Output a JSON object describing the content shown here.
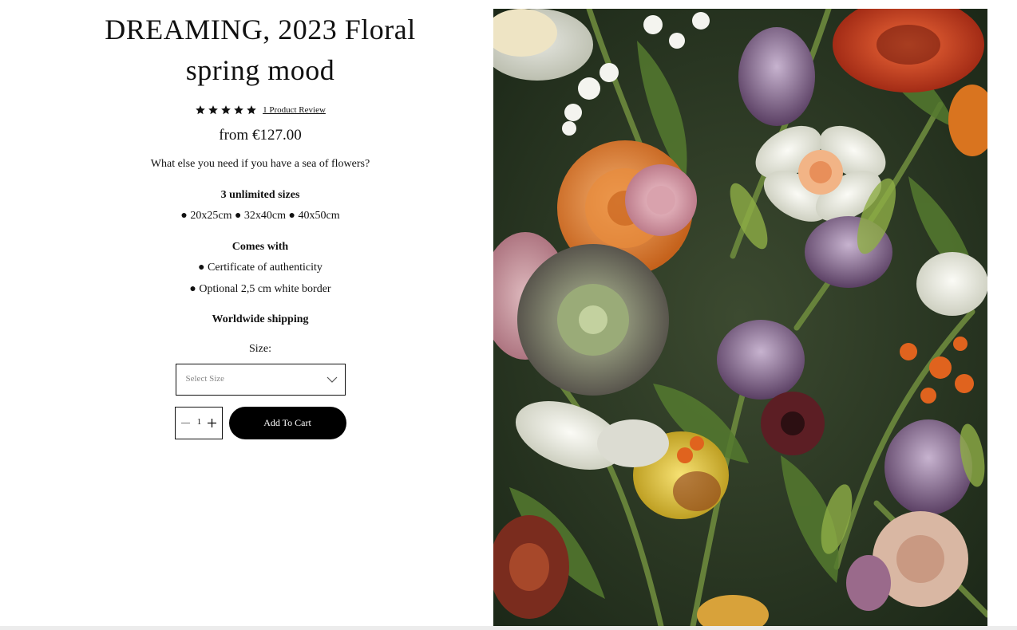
{
  "product": {
    "title": "DREAMING, 2023 Floral spring mood",
    "rating_stars": 5,
    "review_link": "1 Product Review",
    "price": "from €127.00",
    "description": "What else you need if you have a sea of flowers?",
    "sizes_heading": "3 unlimited sizes",
    "sizes_line": "● 20x25cm ● 32x40cm ● 40x50cm",
    "comes_with_heading": "Comes with",
    "comes_with_items": [
      "● Certificate of authenticity",
      "● Optional 2,5 cm white border"
    ],
    "shipping_heading": "Worldwide shipping",
    "size_label": "Size:",
    "size_select_placeholder": "Select Size",
    "quantity": "1",
    "add_to_cart_label": "Add To Cart"
  },
  "icons": {
    "star": "star-icon",
    "chevron": "chevron-down-icon",
    "minus": "minus-icon",
    "plus": "plus-icon"
  },
  "image": {
    "subject": "floral artwork"
  },
  "colors": {
    "button_bg": "#000000",
    "button_text": "#ffffff",
    "text": "#111111",
    "placeholder": "#888888"
  }
}
